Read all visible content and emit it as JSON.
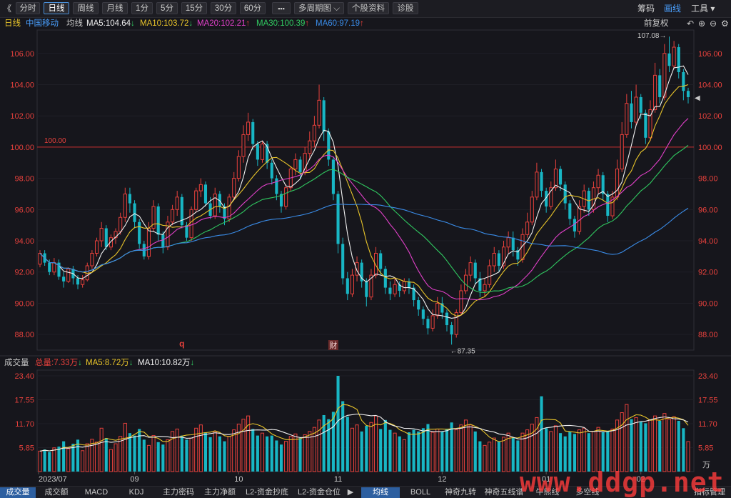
{
  "toolbar": {
    "collapse": "《",
    "buttons": [
      "分时",
      "日线",
      "周线",
      "月线",
      "1分",
      "5分",
      "15分",
      "30分",
      "60分",
      "▪▪▪",
      "多周期图 ⌵",
      "个股资料",
      "诊股"
    ],
    "active": "日线",
    "right": [
      "筹码",
      "画线",
      "工具 ▾"
    ]
  },
  "info": {
    "period": "日线",
    "name": "中国移动",
    "ma_label": "均线",
    "ma5": "MA5:104.64",
    "ma10": "MA10:103.72",
    "ma20": "MA20:102.21",
    "ma30": "MA30:100.39",
    "ma60": "MA60:97.19",
    "adjust": "前复权"
  },
  "colors": {
    "up": "#e8413c",
    "down": "#18b6c4",
    "ma5": "#f0f0f0",
    "ma10": "#e8c42a",
    "ma20": "#e040c8",
    "ma30": "#30c860",
    "ma60": "#3a8ce8",
    "ref": "#d03030"
  },
  "volume": {
    "title": "成交量",
    "total": "总量:7.33万",
    "ma5": "MA5:8.72万",
    "ma10": "MA10:10.82万",
    "unit": "万"
  },
  "markers": {
    "q": "q",
    "cai": "财",
    "high": "107.08",
    "low": "87.35",
    "ref": "100.00"
  },
  "chart_data": {
    "type": "candlestick",
    "y_ticks": [
      "106.00",
      "104.00",
      "102.00",
      "100.00",
      "98.00",
      "96.00",
      "94.00",
      "92.00",
      "90.00",
      "88.00"
    ],
    "ylim": [
      87.0,
      107.5
    ],
    "x_labels": [
      "2023/07",
      "09",
      "10",
      "11",
      "12",
      "01",
      "02"
    ],
    "vol_ticks": [
      "23.40",
      "17.55",
      "11.70",
      "5.85"
    ],
    "vol_ylim": [
      0,
      23.4
    ],
    "highest": 107.08,
    "lowest": 87.35,
    "candles": [
      [
        92.5,
        93.2,
        92.3,
        93.4
      ],
      [
        93.2,
        92.6,
        92.4,
        93.4
      ],
      [
        92.6,
        92.0,
        91.8,
        92.8
      ],
      [
        92.0,
        92.6,
        91.8,
        92.9
      ],
      [
        92.6,
        91.7,
        91.5,
        92.8
      ],
      [
        91.7,
        91.4,
        91.0,
        92.0
      ],
      [
        91.4,
        92.2,
        91.3,
        92.3
      ],
      [
        92.2,
        91.6,
        91.2,
        92.4
      ],
      [
        91.6,
        91.2,
        90.9,
        91.8
      ],
      [
        91.2,
        91.5,
        91.0,
        91.8
      ],
      [
        91.5,
        92.4,
        91.4,
        92.6
      ],
      [
        92.4,
        93.2,
        92.2,
        93.4
      ],
      [
        93.2,
        94.0,
        93.0,
        94.2
      ],
      [
        94.0,
        94.8,
        93.6,
        95.2
      ],
      [
        94.8,
        93.6,
        93.4,
        95.0
      ],
      [
        93.6,
        94.2,
        93.4,
        94.4
      ],
      [
        94.2,
        94.6,
        93.8,
        94.8
      ],
      [
        94.6,
        95.5,
        94.4,
        95.8
      ],
      [
        95.5,
        97.0,
        95.2,
        97.4
      ],
      [
        97.0,
        96.4,
        95.8,
        97.4
      ],
      [
        96.4,
        95.2,
        94.8,
        96.6
      ],
      [
        95.2,
        93.8,
        93.5,
        95.4
      ],
      [
        93.8,
        93.0,
        92.8,
        94.0
      ],
      [
        93.0,
        94.8,
        92.8,
        95.2
      ],
      [
        94.8,
        96.2,
        94.6,
        96.6
      ],
      [
        96.2,
        94.4,
        94.0,
        96.4
      ],
      [
        94.4,
        93.6,
        93.2,
        94.6
      ],
      [
        93.6,
        95.2,
        93.4,
        95.6
      ],
      [
        95.2,
        96.0,
        95.0,
        96.3
      ],
      [
        96.0,
        96.8,
        95.6,
        97.2
      ],
      [
        96.8,
        95.0,
        94.8,
        97.0
      ],
      [
        95.0,
        94.2,
        94.0,
        95.2
      ],
      [
        94.2,
        96.0,
        94.0,
        96.2
      ],
      [
        96.0,
        97.2,
        95.8,
        97.4
      ],
      [
        97.2,
        97.6,
        96.8,
        98.0
      ],
      [
        97.6,
        96.4,
        96.2,
        97.8
      ],
      [
        96.4,
        95.6,
        95.4,
        96.8
      ],
      [
        95.6,
        97.0,
        95.4,
        97.4
      ],
      [
        97.0,
        96.2,
        95.8,
        97.2
      ],
      [
        96.2,
        95.4,
        95.0,
        96.4
      ],
      [
        95.4,
        96.8,
        95.2,
        97.0
      ],
      [
        96.8,
        98.0,
        96.6,
        98.4
      ],
      [
        98.0,
        99.4,
        97.8,
        99.8
      ],
      [
        99.4,
        100.8,
        99.0,
        101.4
      ],
      [
        100.8,
        101.6,
        100.4,
        102.2
      ],
      [
        101.6,
        100.2,
        99.8,
        101.8
      ],
      [
        100.2,
        99.2,
        98.8,
        100.4
      ],
      [
        99.2,
        100.2,
        99.0,
        100.4
      ],
      [
        100.2,
        99.0,
        98.6,
        100.4
      ],
      [
        99.0,
        98.0,
        97.6,
        99.2
      ],
      [
        98.0,
        97.0,
        96.6,
        98.2
      ],
      [
        97.0,
        96.2,
        95.8,
        97.2
      ],
      [
        96.2,
        97.4,
        96.0,
        97.6
      ],
      [
        97.4,
        98.6,
        97.2,
        98.8
      ],
      [
        98.6,
        99.2,
        98.2,
        99.6
      ],
      [
        99.2,
        98.4,
        98.0,
        99.4
      ],
      [
        98.4,
        99.6,
        98.2,
        100.0
      ],
      [
        99.6,
        100.4,
        99.2,
        101.0
      ],
      [
        100.4,
        101.4,
        100.0,
        102.0
      ],
      [
        101.4,
        103.0,
        101.2,
        104.0
      ],
      [
        103.0,
        101.0,
        100.4,
        103.2
      ],
      [
        101.0,
        99.2,
        98.8,
        101.2
      ],
      [
        99.2,
        97.0,
        96.6,
        99.4
      ],
      [
        97.0,
        93.8,
        93.2,
        97.2
      ],
      [
        93.8,
        91.6,
        91.2,
        94.2
      ],
      [
        91.6,
        90.6,
        90.2,
        92.0
      ],
      [
        90.6,
        91.8,
        90.4,
        92.2
      ],
      [
        91.8,
        92.6,
        91.4,
        93.0
      ],
      [
        92.6,
        91.4,
        91.0,
        92.8
      ],
      [
        91.4,
        90.4,
        89.8,
        91.6
      ],
      [
        90.4,
        91.8,
        90.2,
        92.2
      ],
      [
        91.8,
        93.2,
        91.6,
        93.6
      ],
      [
        93.2,
        92.2,
        91.8,
        93.4
      ],
      [
        92.2,
        91.0,
        90.6,
        92.4
      ],
      [
        91.0,
        90.6,
        90.2,
        91.4
      ],
      [
        90.6,
        91.2,
        90.4,
        91.6
      ],
      [
        91.2,
        90.8,
        90.4,
        91.4
      ],
      [
        90.8,
        91.4,
        90.6,
        91.6
      ],
      [
        91.4,
        91.0,
        90.6,
        91.6
      ],
      [
        91.0,
        90.2,
        89.8,
        91.2
      ],
      [
        90.2,
        89.6,
        89.2,
        90.4
      ],
      [
        89.6,
        89.0,
        88.6,
        89.8
      ],
      [
        89.0,
        88.4,
        88.0,
        89.2
      ],
      [
        88.4,
        89.2,
        88.2,
        89.6
      ],
      [
        89.2,
        90.0,
        89.0,
        90.4
      ],
      [
        90.0,
        89.4,
        89.0,
        90.4
      ],
      [
        89.4,
        88.6,
        88.2,
        89.6
      ],
      [
        88.6,
        88.0,
        87.35,
        88.8
      ],
      [
        88.0,
        89.4,
        87.8,
        89.6
      ],
      [
        89.4,
        90.8,
        89.2,
        91.2
      ],
      [
        90.8,
        91.8,
        90.6,
        92.2
      ],
      [
        91.8,
        92.6,
        91.4,
        93.0
      ],
      [
        92.6,
        91.6,
        91.2,
        92.8
      ],
      [
        91.6,
        90.8,
        90.4,
        92.0
      ],
      [
        90.8,
        91.2,
        90.4,
        91.6
      ],
      [
        91.2,
        92.4,
        91.0,
        92.8
      ],
      [
        92.4,
        93.2,
        92.0,
        93.6
      ],
      [
        93.2,
        92.4,
        92.0,
        93.4
      ],
      [
        92.4,
        93.6,
        92.2,
        94.0
      ],
      [
        93.6,
        94.2,
        93.2,
        94.6
      ],
      [
        94.2,
        93.4,
        93.0,
        94.6
      ],
      [
        93.4,
        92.8,
        92.4,
        93.6
      ],
      [
        92.8,
        94.4,
        92.6,
        94.8
      ],
      [
        94.4,
        95.2,
        94.2,
        95.8
      ],
      [
        95.2,
        96.8,
        95.0,
        97.2
      ],
      [
        96.8,
        98.4,
        96.6,
        99.0
      ],
      [
        98.4,
        97.2,
        96.8,
        98.6
      ],
      [
        97.2,
        96.2,
        95.8,
        97.4
      ],
      [
        96.2,
        97.4,
        96.0,
        97.8
      ],
      [
        97.4,
        98.6,
        97.2,
        99.2
      ],
      [
        98.6,
        97.6,
        97.2,
        98.8
      ],
      [
        97.6,
        96.4,
        96.0,
        97.8
      ],
      [
        96.4,
        95.4,
        95.0,
        96.6
      ],
      [
        95.4,
        94.6,
        94.2,
        95.6
      ],
      [
        94.6,
        96.2,
        94.4,
        96.6
      ],
      [
        96.2,
        97.2,
        95.8,
        97.6
      ],
      [
        97.2,
        96.0,
        95.6,
        97.4
      ],
      [
        96.0,
        97.4,
        95.8,
        97.8
      ],
      [
        97.4,
        98.2,
        97.0,
        98.6
      ],
      [
        98.2,
        97.0,
        96.6,
        98.4
      ],
      [
        97.0,
        95.6,
        95.2,
        97.2
      ],
      [
        95.6,
        96.8,
        95.4,
        97.2
      ],
      [
        96.8,
        98.6,
        96.6,
        99.2
      ],
      [
        98.6,
        100.8,
        98.4,
        101.6
      ],
      [
        100.8,
        102.8,
        100.6,
        103.4
      ],
      [
        102.8,
        101.6,
        101.2,
        103.6
      ],
      [
        101.6,
        103.2,
        101.4,
        104.0
      ],
      [
        103.2,
        102.2,
        101.8,
        103.4
      ],
      [
        102.2,
        100.6,
        100.2,
        102.4
      ],
      [
        100.6,
        102.4,
        100.4,
        103.0
      ],
      [
        102.4,
        104.6,
        102.2,
        105.4
      ],
      [
        104.6,
        103.2,
        102.8,
        105.0
      ],
      [
        103.2,
        106.0,
        103.0,
        106.6
      ],
      [
        106.0,
        105.2,
        104.8,
        107.08
      ],
      [
        105.2,
        106.4,
        105.0,
        106.8
      ],
      [
        106.4,
        104.8,
        104.4,
        106.6
      ],
      [
        104.8,
        103.6,
        103.0,
        105.0
      ],
      [
        103.6,
        103.2,
        102.8,
        103.8
      ]
    ],
    "volumes": [
      [
        5.0,
        1
      ],
      [
        5.4,
        0
      ],
      [
        4.8,
        0
      ],
      [
        5.8,
        1
      ],
      [
        6.1,
        0
      ],
      [
        7.4,
        0
      ],
      [
        5.6,
        1
      ],
      [
        6.8,
        0
      ],
      [
        7.8,
        0
      ],
      [
        5.1,
        1
      ],
      [
        6.8,
        1
      ],
      [
        7.9,
        1
      ],
      [
        7.2,
        1
      ],
      [
        10.6,
        1
      ],
      [
        8.2,
        0
      ],
      [
        5.4,
        1
      ],
      [
        6.8,
        1
      ],
      [
        8.6,
        1
      ],
      [
        11.8,
        1
      ],
      [
        9.4,
        0
      ],
      [
        8.8,
        0
      ],
      [
        10.4,
        0
      ],
      [
        7.8,
        0
      ],
      [
        6.4,
        1
      ],
      [
        8.8,
        1
      ],
      [
        7.2,
        0
      ],
      [
        6.6,
        0
      ],
      [
        7.8,
        1
      ],
      [
        9.8,
        1
      ],
      [
        10.4,
        1
      ],
      [
        8.8,
        0
      ],
      [
        7.8,
        0
      ],
      [
        8.2,
        1
      ],
      [
        10.6,
        1
      ],
      [
        11.4,
        1
      ],
      [
        9.6,
        0
      ],
      [
        8.4,
        0
      ],
      [
        9.8,
        1
      ],
      [
        8.6,
        0
      ],
      [
        7.4,
        0
      ],
      [
        8.6,
        1
      ],
      [
        10.2,
        1
      ],
      [
        11.6,
        1
      ],
      [
        12.8,
        1
      ],
      [
        13.6,
        1
      ],
      [
        10.4,
        0
      ],
      [
        8.8,
        0
      ],
      [
        9.4,
        1
      ],
      [
        8.6,
        0
      ],
      [
        8.8,
        0
      ],
      [
        7.6,
        0
      ],
      [
        6.6,
        0
      ],
      [
        7.4,
        1
      ],
      [
        8.6,
        1
      ],
      [
        9.2,
        1
      ],
      [
        8.2,
        0
      ],
      [
        9.0,
        1
      ],
      [
        9.8,
        1
      ],
      [
        10.8,
        1
      ],
      [
        12.6,
        1
      ],
      [
        13.8,
        0
      ],
      [
        12.8,
        0
      ],
      [
        14.6,
        0
      ],
      [
        23.4,
        0
      ],
      [
        17.2,
        0
      ],
      [
        13.4,
        0
      ],
      [
        10.6,
        1
      ],
      [
        11.4,
        1
      ],
      [
        9.8,
        0
      ],
      [
        11.2,
        0
      ],
      [
        12.0,
        1
      ],
      [
        13.6,
        1
      ],
      [
        10.4,
        0
      ],
      [
        12.6,
        0
      ],
      [
        10.2,
        0
      ],
      [
        9.4,
        1
      ],
      [
        8.6,
        0
      ],
      [
        7.8,
        1
      ],
      [
        9.6,
        0
      ],
      [
        10.2,
        0
      ],
      [
        9.8,
        0
      ],
      [
        10.6,
        0
      ],
      [
        11.6,
        0
      ],
      [
        9.6,
        1
      ],
      [
        10.4,
        1
      ],
      [
        9.8,
        0
      ],
      [
        10.4,
        0
      ],
      [
        12.0,
        0
      ],
      [
        10.2,
        1
      ],
      [
        11.4,
        1
      ],
      [
        12.6,
        1
      ],
      [
        11.4,
        1
      ],
      [
        9.8,
        0
      ],
      [
        7.4,
        0
      ],
      [
        6.4,
        1
      ],
      [
        7.2,
        1
      ],
      [
        8.2,
        1
      ],
      [
        7.4,
        0
      ],
      [
        8.4,
        1
      ],
      [
        9.4,
        1
      ],
      [
        8.2,
        0
      ],
      [
        7.6,
        0
      ],
      [
        9.4,
        1
      ],
      [
        10.2,
        1
      ],
      [
        11.6,
        1
      ],
      [
        13.2,
        1
      ],
      [
        18.4,
        0
      ],
      [
        10.6,
        0
      ],
      [
        9.8,
        1
      ],
      [
        11.2,
        1
      ],
      [
        9.4,
        0
      ],
      [
        8.6,
        0
      ],
      [
        9.8,
        0
      ],
      [
        9.2,
        0
      ],
      [
        10.2,
        1
      ],
      [
        10.6,
        1
      ],
      [
        9.4,
        0
      ],
      [
        9.8,
        1
      ],
      [
        10.8,
        1
      ],
      [
        9.6,
        0
      ],
      [
        9.8,
        0
      ],
      [
        10.4,
        1
      ],
      [
        12.6,
        1
      ],
      [
        14.4,
        1
      ],
      [
        16.4,
        1
      ],
      [
        12.8,
        0
      ],
      [
        13.2,
        1
      ],
      [
        12.2,
        0
      ],
      [
        11.8,
        0
      ],
      [
        12.6,
        1
      ],
      [
        13.6,
        1
      ],
      [
        12.4,
        0
      ],
      [
        14.2,
        1
      ],
      [
        12.8,
        1
      ],
      [
        13.4,
        1
      ],
      [
        12.4,
        0
      ],
      [
        10.6,
        0
      ],
      [
        7.33,
        1
      ]
    ]
  },
  "bottom": {
    "tabs_left": [
      "成交量",
      "成交额",
      "MACD",
      "KDJ",
      "主力密码",
      "主力净额",
      "L2-资金抄底",
      "L2-资金仓位"
    ],
    "arrow": "▶",
    "tabs_right": [
      "均线",
      "BOLL",
      "神奇九转",
      "神奇五线谱",
      "牛熊线",
      "多空线",
      "指标管理"
    ]
  },
  "watermark": "www.ddgp.net"
}
